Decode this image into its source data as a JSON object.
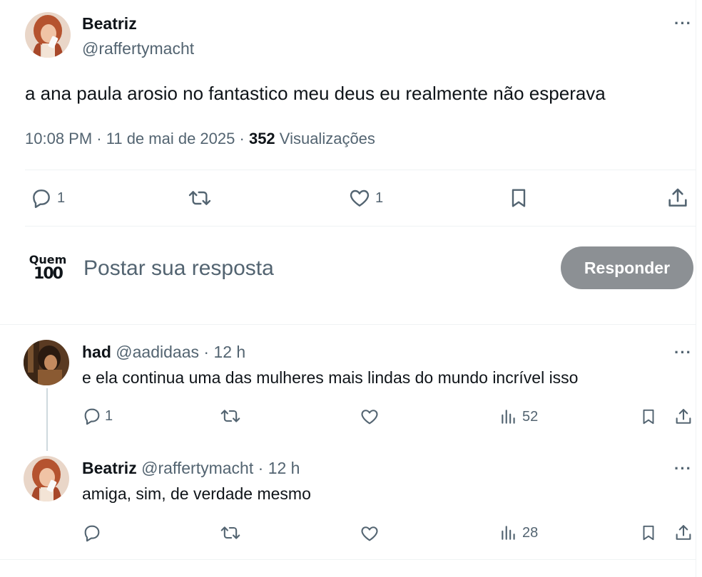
{
  "colors": {
    "text": "#0f1419",
    "muted": "#536471",
    "divider": "#eff3f4",
    "reply_button_bg": "#8c9094",
    "reply_button_text": "#ffffff"
  },
  "main_tweet": {
    "author_name": "Beatriz",
    "author_handle": "@raffertymacht",
    "more_label": "···",
    "text": "a ana paula arosio no fantastico meu deus eu realmente não esperava",
    "time": "10:08 PM",
    "sep1": "·",
    "date": "11 de mai de 2025",
    "sep2": "·",
    "views_count": "352",
    "views_label": "Visualizações",
    "actions": {
      "reply_count": "1",
      "like_count": "1"
    }
  },
  "composer": {
    "logo_line1": "Quem",
    "logo_line2": "100",
    "placeholder": "Postar sua resposta",
    "button_label": "Responder"
  },
  "replies": [
    {
      "author_name": "had",
      "author_handle": "@aadidaas",
      "sep": "·",
      "time": "12 h",
      "more_label": "···",
      "text": "e ela continua uma das mulheres mais lindas do mundo incrível isso",
      "reply_count": "1",
      "views_count": "52"
    },
    {
      "author_name": "Beatriz",
      "author_handle": "@raffertymacht",
      "sep": "·",
      "time": "12 h",
      "more_label": "···",
      "text": "amiga, sim, de verdade mesmo",
      "reply_count": "",
      "views_count": "28"
    }
  ]
}
